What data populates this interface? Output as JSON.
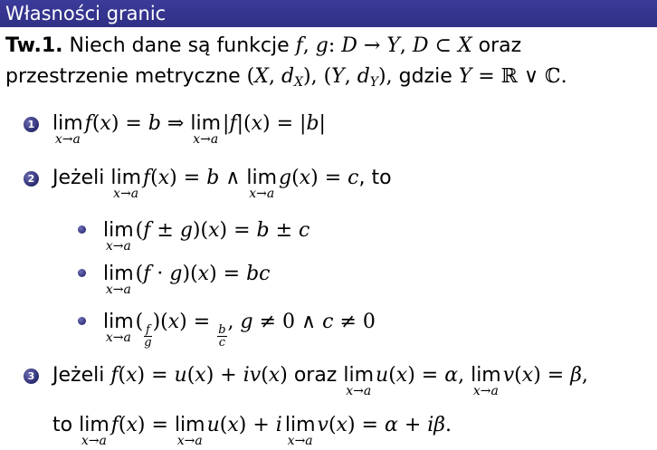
{
  "title": "Własności granic",
  "theorem_label": "Tw.1.",
  "theorem_text_1": "Niech dane są funkcje",
  "theorem_text_2": "oraz",
  "theorem_text_3": "przestrzenie metryczne",
  "theorem_text_4": "gdzie",
  "items": {
    "one_number": "1",
    "two_number": "2",
    "three_number": "3",
    "jezeli": "Jeżeli",
    "to_comma": ", to",
    "oraz": "oraz",
    "to": "to",
    "lim": "lim",
    "under": "x→a"
  }
}
